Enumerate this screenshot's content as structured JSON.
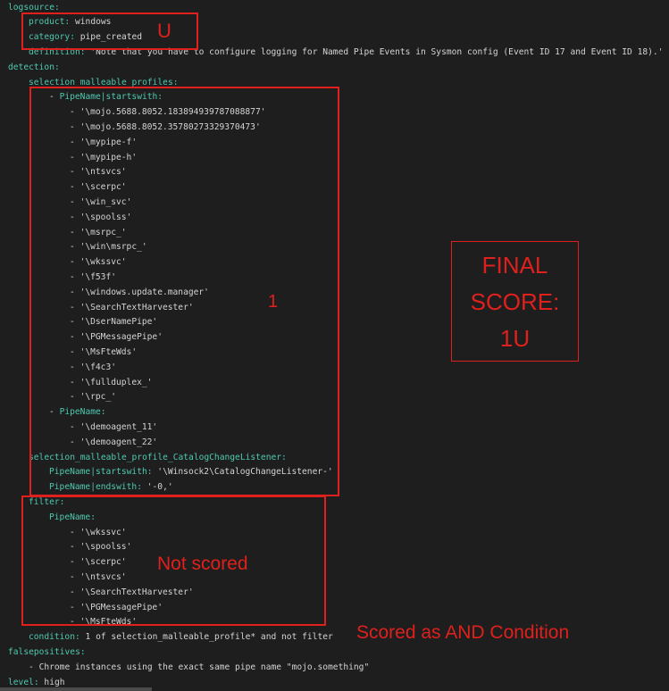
{
  "editor": {
    "lines": [
      {
        "indent": 0,
        "key": "logsource:",
        "value": ""
      },
      {
        "indent": 1,
        "key": "product:",
        "value": " windows"
      },
      {
        "indent": 1,
        "key": "category:",
        "value": " pipe_created"
      },
      {
        "indent": 1,
        "key": "definition:",
        "value": " 'Note that you have to configure logging for Named Pipe Events in Sysmon config (Event ID 17 and Event ID 18).'"
      },
      {
        "indent": 0,
        "key": "detection:",
        "value": ""
      },
      {
        "indent": 1,
        "key": "selection_malleable_profiles:",
        "value": ""
      },
      {
        "indent": 2,
        "dash": "- ",
        "key": "PipeName|startswith:",
        "value": ""
      },
      {
        "indent": 3,
        "dash": "- ",
        "key": "",
        "value": "'\\mojo.5688.8052.183894939787088877'"
      },
      {
        "indent": 3,
        "dash": "- ",
        "key": "",
        "value": "'\\mojo.5688.8052.35780273329370473'"
      },
      {
        "indent": 3,
        "dash": "- ",
        "key": "",
        "value": "'\\mypipe-f'"
      },
      {
        "indent": 3,
        "dash": "- ",
        "key": "",
        "value": "'\\mypipe-h'"
      },
      {
        "indent": 3,
        "dash": "- ",
        "key": "",
        "value": "'\\ntsvcs'"
      },
      {
        "indent": 3,
        "dash": "- ",
        "key": "",
        "value": "'\\scerpc'"
      },
      {
        "indent": 3,
        "dash": "- ",
        "key": "",
        "value": "'\\win_svc'"
      },
      {
        "indent": 3,
        "dash": "- ",
        "key": "",
        "value": "'\\spoolss'"
      },
      {
        "indent": 3,
        "dash": "- ",
        "key": "",
        "value": "'\\msrpc_'"
      },
      {
        "indent": 3,
        "dash": "- ",
        "key": "",
        "value": "'\\win\\msrpc_'"
      },
      {
        "indent": 3,
        "dash": "- ",
        "key": "",
        "value": "'\\wkssvc'"
      },
      {
        "indent": 3,
        "dash": "- ",
        "key": "",
        "value": "'\\f53f'"
      },
      {
        "indent": 3,
        "dash": "- ",
        "key": "",
        "value": "'\\windows.update.manager'"
      },
      {
        "indent": 3,
        "dash": "- ",
        "key": "",
        "value": "'\\SearchTextHarvester'"
      },
      {
        "indent": 3,
        "dash": "- ",
        "key": "",
        "value": "'\\DserNamePipe'"
      },
      {
        "indent": 3,
        "dash": "- ",
        "key": "",
        "value": "'\\PGMessagePipe'"
      },
      {
        "indent": 3,
        "dash": "- ",
        "key": "",
        "value": "'\\MsFteWds'"
      },
      {
        "indent": 3,
        "dash": "- ",
        "key": "",
        "value": "'\\f4c3'"
      },
      {
        "indent": 3,
        "dash": "- ",
        "key": "",
        "value": "'\\fullduplex_'"
      },
      {
        "indent": 3,
        "dash": "- ",
        "key": "",
        "value": "'\\rpc_'"
      },
      {
        "indent": 2,
        "dash": "- ",
        "key": "PipeName:",
        "value": ""
      },
      {
        "indent": 3,
        "dash": "- ",
        "key": "",
        "value": "'\\demoagent_11'"
      },
      {
        "indent": 3,
        "dash": "- ",
        "key": "",
        "value": "'\\demoagent_22'"
      },
      {
        "indent": 1,
        "key": "selection_malleable_profile_CatalogChangeListener:",
        "value": ""
      },
      {
        "indent": 2,
        "key": "PipeName|startswith:",
        "value": " '\\Winsock2\\CatalogChangeListener-'"
      },
      {
        "indent": 2,
        "key": "PipeName|endswith:",
        "value": " '-0,'"
      },
      {
        "indent": 1,
        "key": "filter:",
        "value": ""
      },
      {
        "indent": 2,
        "key": "PipeName:",
        "value": ""
      },
      {
        "indent": 3,
        "dash": "- ",
        "key": "",
        "value": "'\\wkssvc'"
      },
      {
        "indent": 3,
        "dash": "- ",
        "key": "",
        "value": "'\\spoolss'"
      },
      {
        "indent": 3,
        "dash": "- ",
        "key": "",
        "value": "'\\scerpc'"
      },
      {
        "indent": 3,
        "dash": "- ",
        "key": "",
        "value": "'\\ntsvcs'"
      },
      {
        "indent": 3,
        "dash": "- ",
        "key": "",
        "value": "'\\SearchTextHarvester'"
      },
      {
        "indent": 3,
        "dash": "- ",
        "key": "",
        "value": "'\\PGMessagePipe'"
      },
      {
        "indent": 3,
        "dash": "- ",
        "key": "",
        "value": "'\\MsFteWds'"
      },
      {
        "indent": 1,
        "key": "condition:",
        "value": " 1 of selection_malleable_profile* and not filter"
      },
      {
        "indent": 0,
        "key": "falsepositives:",
        "value": ""
      },
      {
        "indent": 1,
        "dash": "- ",
        "key": "",
        "value": "Chrome instances using the exact same pipe name \"mojo.something\""
      },
      {
        "indent": 0,
        "key": "level:",
        "value": " high"
      }
    ]
  },
  "annotations": {
    "u_label": "U",
    "one_label": "1",
    "final_score": {
      "line1": "FINAL",
      "line2": "SCORE:",
      "line3": "1U"
    },
    "not_scored": "Not scored",
    "and_condition": "Scored as AND Condition"
  },
  "colors": {
    "background": "#1e1e1e",
    "key": "#4ec9b0",
    "text": "#d4d4d4",
    "annotation": "#e0201c"
  }
}
